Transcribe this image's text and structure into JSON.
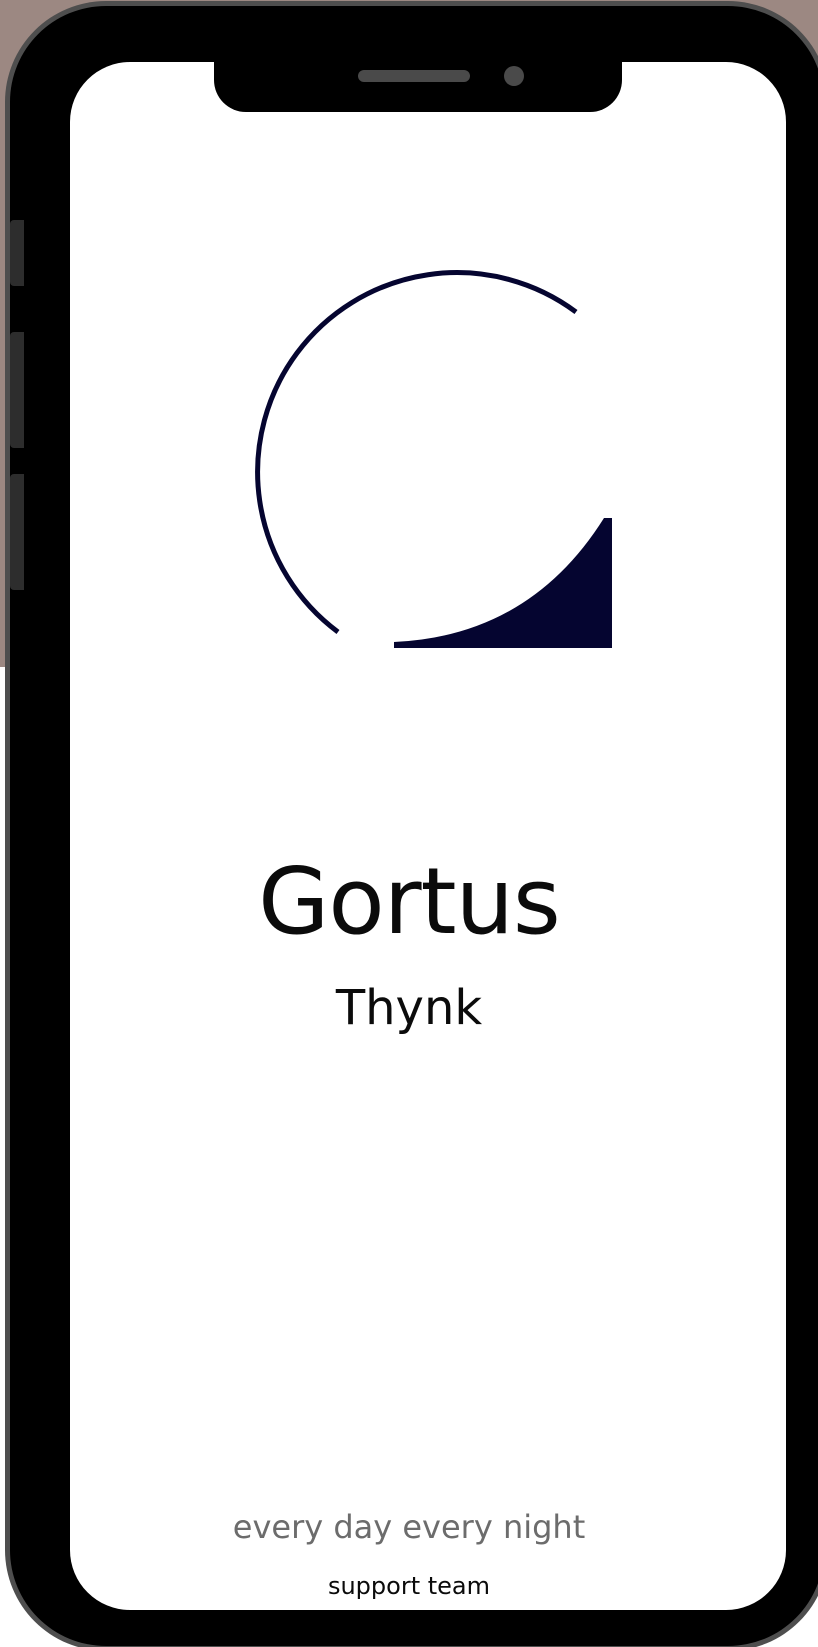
{
  "splash": {
    "title": "Gortus",
    "subtitle": "Thynk",
    "tagline": "every day every night",
    "footer": "support team"
  },
  "logo": {
    "icon": "gortus-g-logo-icon",
    "color": "#050530"
  },
  "colors": {
    "backdrop": "#9c8882",
    "device_frame": "#000000",
    "screen": "#ffffff",
    "text_primary": "#0b0b0b",
    "text_secondary": "#6c6c6c"
  }
}
